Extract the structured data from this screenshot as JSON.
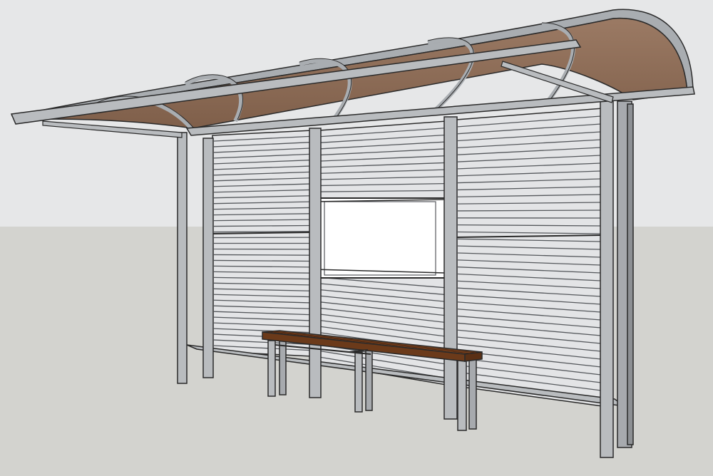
{
  "scene": {
    "subject": "bus-shelter-3d-model",
    "colors": {
      "sky": "#e6e7e8",
      "ground": "#d3d3cf",
      "frame": "#b9bcbf",
      "frame_dark": "#8d9094",
      "wall": "#e3e4e6",
      "slat": "#55585c",
      "roof_panel": "#8b6a55",
      "roof_frame": "#a9adb1",
      "bench_wood": "#8a4e25",
      "bench_wood_dark": "#6b3a1a",
      "poster": "#ffffff",
      "outline": "#2a2a2a"
    }
  }
}
